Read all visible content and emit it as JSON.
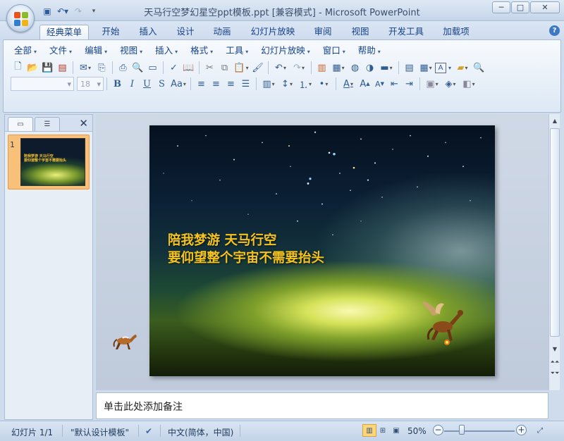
{
  "window": {
    "title": "天马行空梦幻星空ppt模板.ppt [兼容模式] - Microsoft PowerPoint",
    "minimize": "─",
    "maximize": "□",
    "close": "✕"
  },
  "ribbon_tabs": [
    {
      "label": "经典菜单",
      "active": true
    },
    {
      "label": "开始"
    },
    {
      "label": "插入"
    },
    {
      "label": "设计"
    },
    {
      "label": "动画"
    },
    {
      "label": "幻灯片放映"
    },
    {
      "label": "审阅"
    },
    {
      "label": "视图"
    },
    {
      "label": "开发工具"
    },
    {
      "label": "加载项"
    }
  ],
  "menus": [
    "全部",
    "文件",
    "编辑",
    "视图",
    "插入",
    "格式",
    "工具",
    "幻灯片放映",
    "窗口",
    "帮助"
  ],
  "font": {
    "size": "18"
  },
  "outline_panel": {
    "slide_number": "1",
    "thumb_text": "陪我梦游 天马行空\n要仰望整个宇宙不需要抬头"
  },
  "slide": {
    "line1": "陪我梦游 天马行空",
    "line2": "要仰望整个宇宙不需要抬头"
  },
  "notes": {
    "placeholder": "单击此处添加备注"
  },
  "status": {
    "slide_info": "幻灯片 1/1",
    "theme": "\"默认设计模板\"",
    "language": "中文(简体，中国)",
    "zoom": "50%"
  },
  "colors": {
    "title_text": "#f6c21c",
    "active_slide_frame": "#f9c07a"
  }
}
